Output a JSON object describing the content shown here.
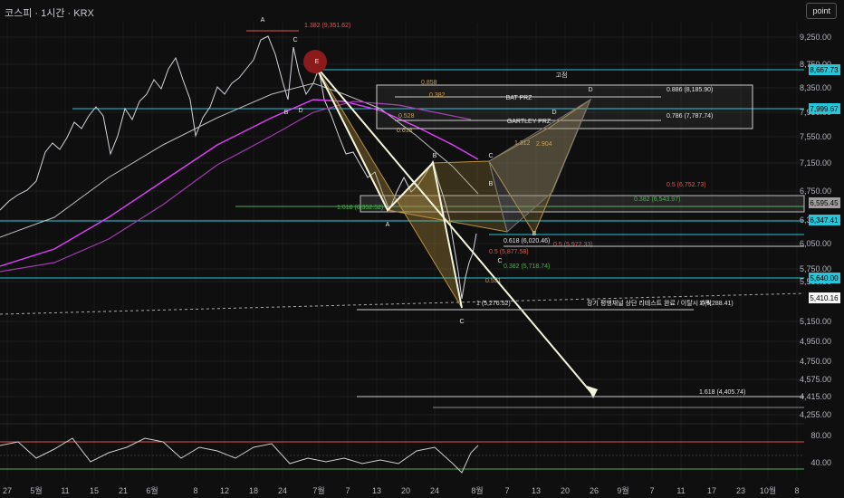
{
  "header": {
    "title": "코스피 · 1시간 · KRX",
    "corner_button": "point"
  },
  "chart_data": {
    "type": "line",
    "symbol": "코스피",
    "interval": "1시간",
    "exchange": "KRX",
    "y_axis_ticks": [
      "9,250.00",
      "8,750.00",
      "8,350.00",
      "7,950.00",
      "7,550.00",
      "7,150.00",
      "6,750.00",
      "6,350.00",
      "6,050.00",
      "5,750.00",
      "5,550.00",
      "5,150.00",
      "4,950.00",
      "4,750.00",
      "4,575.00",
      "4,415.00",
      "4,255.00"
    ],
    "x_axis_ticks": [
      "27",
      "5월",
      "11",
      "15",
      "21",
      "6월",
      "8",
      "12",
      "18",
      "24",
      "7월",
      "7",
      "13",
      "20",
      "24",
      "8월",
      "7",
      "13",
      "20",
      "26",
      "9월",
      "7",
      "11",
      "17",
      "23",
      "10월",
      "8"
    ],
    "price_tags": [
      {
        "label": "8,667.73",
        "color": "#26c6da"
      },
      {
        "label": "7,999.67",
        "color": "#26c6da"
      },
      {
        "label": "6,595.45",
        "color": "#9e9e9e"
      },
      {
        "label": "6,347.41",
        "color": "#26c6da"
      },
      {
        "label": "5,640.00",
        "color": "#26c6da"
      },
      {
        "label": "5,410.16",
        "color": "#f5f5f5"
      }
    ],
    "pattern_points": [
      "A",
      "C",
      "B",
      "D",
      "E",
      "A",
      "B",
      "C",
      "B",
      "C",
      "D",
      "B",
      "C"
    ],
    "level_labels": [
      {
        "text": "1.382 (9,351.62)",
        "color": "#e05555"
      },
      {
        "text": "0.886 (8,185.90)",
        "color": "#e6e6e6"
      },
      {
        "text": "0.786 (7,787.74)",
        "color": "#e6e6e6"
      },
      {
        "text": "0.5 (6,752.73)",
        "color": "#e05555"
      },
      {
        "text": "0.382 (6,543.97)",
        "color": "#4caf50"
      },
      {
        "text": "1.618 (6,352.52)",
        "color": "#4caf50"
      },
      {
        "text": "0.618 (6,020.46)",
        "color": "#e6e6e6"
      },
      {
        "text": "0.5 (5,972.33)",
        "color": "#e05555"
      },
      {
        "text": "0.5 (5,877.58)",
        "color": "#e05555"
      },
      {
        "text": "0.382 (5,718.74)",
        "color": "#4caf50"
      },
      {
        "text": "1 (5,276.52)",
        "color": "#e6e6e6"
      },
      {
        "text": "1 (5,288.41)",
        "color": "#e6e6e6"
      },
      {
        "text": "1.618 (4,405.74)",
        "color": "#e6e6e6"
      }
    ],
    "ratio_labels": [
      "0.858",
      "0.382",
      "0.528",
      "0.618",
      "1.312",
      "2.904",
      "0.531"
    ],
    "prz_box": {
      "title": "고점",
      "label_d": "D",
      "bat": "BAT PRZ",
      "gartley": "GARTLEY PRZ"
    },
    "annotation": "장기 평행채널 상단 리테스트 완료 / 이탈시 추락",
    "oscillator": {
      "ticks": [
        "80.00",
        "40.00"
      ]
    },
    "colors": {
      "bg": "#0f0f0f",
      "up": "#d1d4dc",
      "ma_pink": "#e040fb",
      "ma_gray": "#bdbdbd",
      "cyan": "#26c6da",
      "harmonic": "#b8923e",
      "arrow": "#f5f5dc"
    }
  }
}
